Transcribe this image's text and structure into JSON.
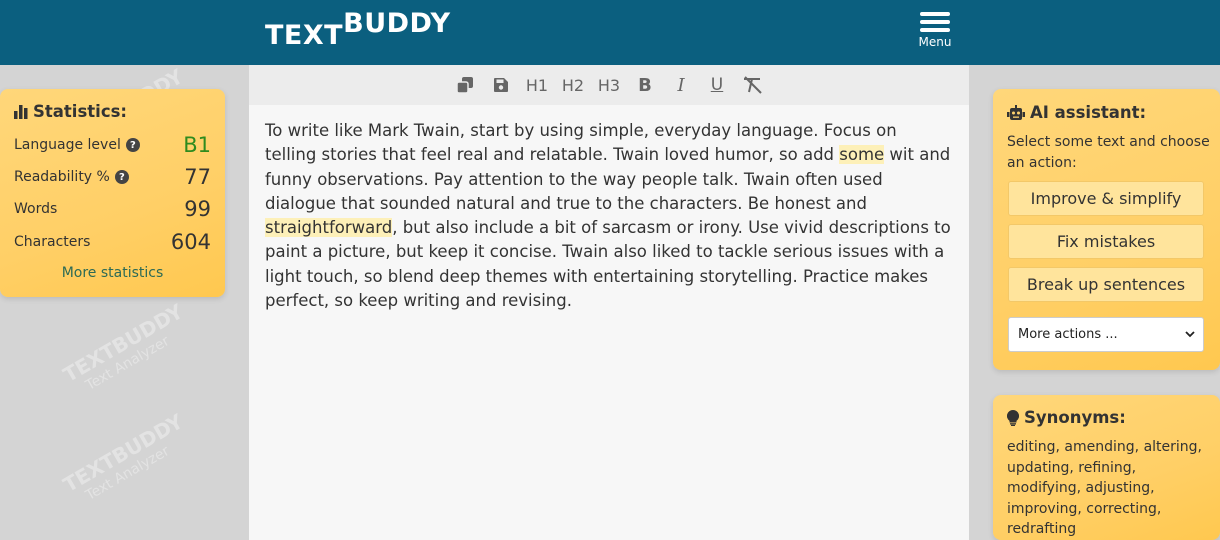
{
  "header": {
    "logo_part1": "TEXT",
    "logo_part2": "BUDDY",
    "menu_label": "Menu",
    "bg_color": "#0b5f7f"
  },
  "watermark": {
    "brand": "TEXTBUDDY",
    "tagline": "Text Analyzer"
  },
  "toolbar": {
    "copy_icon": "copy-icon",
    "save_icon": "save-icon",
    "h1": "H1",
    "h2": "H2",
    "h3": "H3",
    "bold": "B",
    "italic": "I",
    "underline": "U",
    "clear_format_icon": "clear-format-icon"
  },
  "editor": {
    "text_segments": [
      "To write like Mark Twain, start by using simple, everyday language. Focus on telling stories that feel real and relatable. Twain loved humor, so add ",
      "some",
      " wit and funny observations. Pay attention to the way people talk. Twain often used dialogue that sounded natural and true to the characters. Be honest and ",
      "straightforward",
      ", but also include a bit of sarcasm or irony. Use vivid descriptions to paint a picture, but keep it concise. Twain also liked to tackle serious issues with a light touch, so blend deep themes with entertaining storytelling. Practice makes perfect, so keep writing and revising."
    ],
    "highlight_color": "#fdf0b8"
  },
  "statistics": {
    "title": "Statistics:",
    "rows": [
      {
        "label": "Language level",
        "value": "B1",
        "help": true
      },
      {
        "label": "Readability %",
        "value": "77",
        "help": true
      },
      {
        "label": "Words",
        "value": "99",
        "help": false
      },
      {
        "label": "Characters",
        "value": "604",
        "help": false
      }
    ],
    "more_link": "More statistics",
    "level_color": "#2e8b1e"
  },
  "ai_assistant": {
    "title": "AI assistant:",
    "hint": "Select some text and choose an action:",
    "buttons": [
      "Improve & simplify",
      "Fix mistakes",
      "Break up sentences"
    ],
    "select_value": "More actions ..."
  },
  "synonyms": {
    "title": "Synonyms:",
    "text": "editing, amending, altering, updating, refining, modifying, adjusting, improving, correcting, redrafting"
  },
  "panel_color": "#ffcf66"
}
